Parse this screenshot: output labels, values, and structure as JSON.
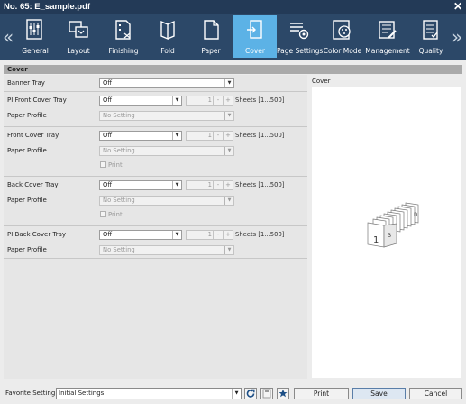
{
  "window": {
    "title": "No. 65: E_sample.pdf",
    "close_icon": "close-icon"
  },
  "toolbar": {
    "tabs": [
      {
        "label": "General",
        "icon": "general-icon",
        "active": false
      },
      {
        "label": "Layout",
        "icon": "layout-icon",
        "active": false
      },
      {
        "label": "Finishing",
        "icon": "finishing-icon",
        "active": false
      },
      {
        "label": "Fold",
        "icon": "fold-icon",
        "active": false
      },
      {
        "label": "Paper",
        "icon": "paper-icon",
        "active": false
      },
      {
        "label": "Cover",
        "icon": "cover-icon",
        "active": true
      },
      {
        "label": "Page Settings",
        "icon": "page-settings-icon",
        "active": false
      },
      {
        "label": "Color Mode",
        "icon": "color-mode-icon",
        "active": false
      },
      {
        "label": "Management",
        "icon": "management-icon",
        "active": false
      },
      {
        "label": "Quality",
        "icon": "quality-icon",
        "active": false
      }
    ],
    "prev_arrow": "«",
    "next_arrow": "»"
  },
  "section": {
    "title": "Cover"
  },
  "form": {
    "banner_tray": {
      "label": "Banner Tray",
      "value": "Off"
    },
    "pi_front": {
      "label": "PI Front Cover Tray",
      "value": "Off",
      "sheets_value": "1",
      "sheets_label": "Sheets [1...500]",
      "profile_label": "Paper Profile",
      "profile_value": "No Setting"
    },
    "front": {
      "label": "Front Cover Tray",
      "value": "Off",
      "sheets_value": "1",
      "sheets_label": "Sheets [1...500]",
      "profile_label": "Paper Profile",
      "profile_value": "No Setting",
      "print_label": "Print"
    },
    "back": {
      "label": "Back Cover Tray",
      "value": "Off",
      "sheets_value": "1",
      "sheets_label": "Sheets [1...500]",
      "profile_label": "Paper Profile",
      "profile_value": "No Setting",
      "print_label": "Print"
    },
    "pi_back": {
      "label": "PI Back Cover Tray",
      "value": "Off",
      "sheets_value": "1",
      "sheets_label": "Sheets [1...500]",
      "profile_label": "Paper Profile",
      "profile_value": "No Setting"
    },
    "minus": "-",
    "plus": "+"
  },
  "preview": {
    "title": "Cover",
    "first_page": "1",
    "third_page": "3",
    "last_page": "n"
  },
  "footer": {
    "favorite_label": "Favorite Setting",
    "favorite_value": "Initial Settings",
    "print": "Print",
    "save": "Save",
    "cancel": "Cancel"
  },
  "colors": {
    "titlebar": "#233a57",
    "toolbar": "#2c4868",
    "active_tab": "#5cb2e6"
  }
}
